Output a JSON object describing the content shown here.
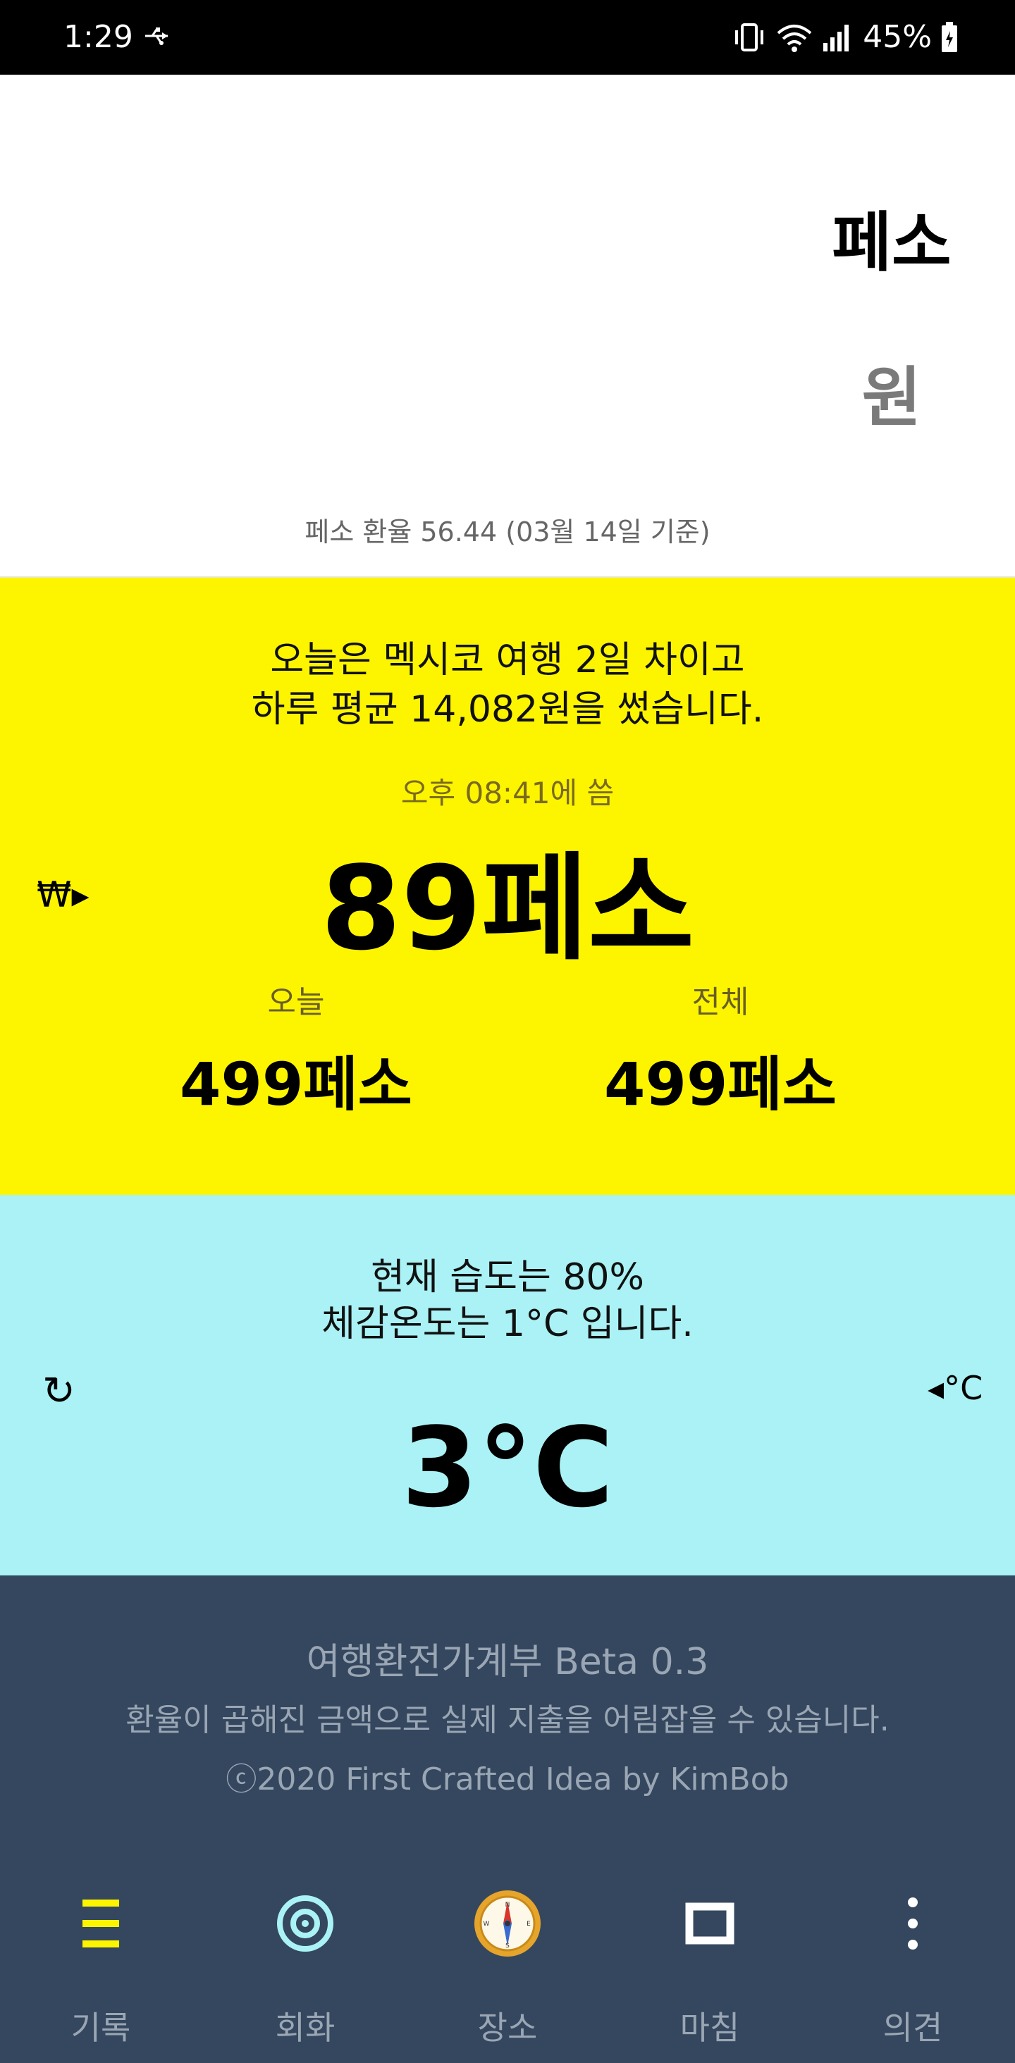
{
  "status_bar": {
    "time": "1:29",
    "battery": "45%"
  },
  "converter": {
    "peso_label": "페소",
    "won_label": "원",
    "rate_text": "페소 환율 56.44 (03월 14일 기준)"
  },
  "spending": {
    "summary_line1": "오늘은 멕시코 여행 2일 차이고",
    "summary_line2": "하루 평균 14,082원을 썼습니다.",
    "spent_time": "오후 08:41에 씀",
    "last_amount": "89페소",
    "currency_switch": "₩▸",
    "today_label": "오늘",
    "today_value": "499페소",
    "total_label": "전체",
    "total_value": "499페소"
  },
  "weather": {
    "line1": "현재 습도는 80%",
    "line2": "체감온도는 1°C 입니다.",
    "temperature": "3°C",
    "refresh_symbol": "↻",
    "unit_switch": "◂°C"
  },
  "footer": {
    "app_title": "여행환전가계부 Beta 0.3",
    "description": "환율이 곱해진 금액으로 실제 지출을 어림잡을 수 있습니다.",
    "copyright": "ⓒ2020 First Crafted Idea by KimBob"
  },
  "nav": {
    "items": [
      {
        "label": "기록",
        "icon": "list-icon"
      },
      {
        "label": "회화",
        "icon": "target-icon"
      },
      {
        "label": "장소",
        "icon": "compass-icon"
      },
      {
        "label": "마침",
        "icon": "square-icon"
      },
      {
        "label": "의견",
        "icon": "more-vertical-icon"
      }
    ]
  },
  "colors": {
    "yellow": "#fdf500",
    "cyan": "#aaf2f5",
    "footer": "#34475e",
    "nav_active": "#fdf500"
  }
}
